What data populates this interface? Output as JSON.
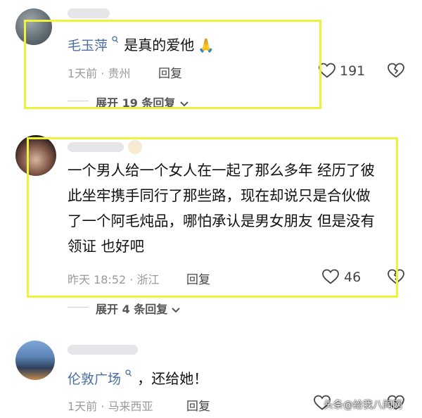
{
  "comments": [
    {
      "username": "毛玉萍",
      "text": "是真的爱他",
      "emoji": "🙏",
      "time": "1天前",
      "location": "贵州",
      "reply_label": "回复",
      "likes": "191",
      "expand_label": "展开 19 条回复"
    },
    {
      "text_lines": [
        "一个男人给一个女人在一起了那么多年 经历了彼",
        "此坐牢携手同行了那些路，现在却说只是合伙做",
        "了一个阿毛炖品，哪怕承认是男女朋友 但是没有",
        "领证 也好吧"
      ],
      "time": "昨天 18:52",
      "location": "浙江",
      "reply_label": "回复",
      "likes": "46",
      "expand_label": "展开 4 条回复"
    },
    {
      "username": "伦敦广场",
      "text": "，还给她！",
      "time": "1天前",
      "location": "马来西亚",
      "reply_label": "回复"
    }
  ],
  "watermark": "头条@给我八闻网",
  "colors": {
    "highlight": "#eef23a",
    "username": "#4b6fa0",
    "meta": "#9a9a9a"
  },
  "icons": [
    "search-icon",
    "heart-icon",
    "dislike-icon",
    "chevron-down-icon"
  ]
}
